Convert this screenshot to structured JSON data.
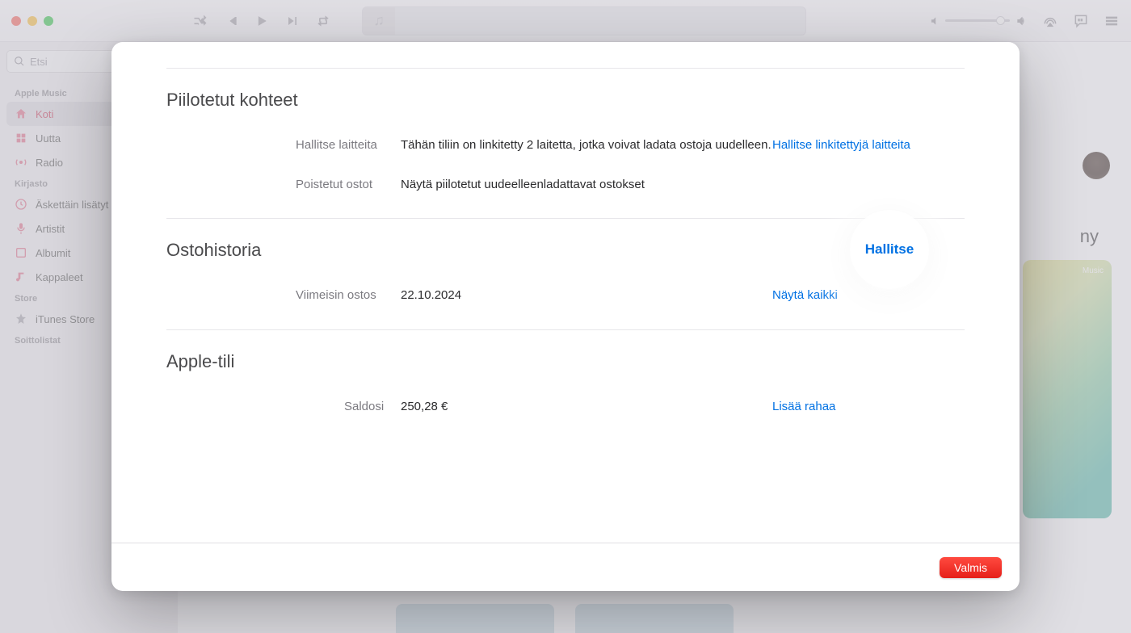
{
  "search_placeholder": "Etsi",
  "sidebar": {
    "section_music": "Apple Music",
    "home": "Koti",
    "new": "Uutta",
    "radio": "Radio",
    "section_library": "Kirjasto",
    "recent": "Äskettäin lisätyt",
    "artists": "Artistit",
    "albums": "Albumit",
    "songs": "Kappaleet",
    "section_store": "Store",
    "itunes": "iTunes Store",
    "section_playlists": "Soittolistat"
  },
  "bg": {
    "hero_word_partial": "ny",
    "hero_badge": "Music"
  },
  "modal": {
    "hidden": {
      "title": "Piilotetut kohteet",
      "devices_label": "Hallitse laitteita",
      "devices_text": "Tähän tiliin on linkitetty 2 laitetta, jotka voivat ladata ostoja uudelleen.",
      "devices_action": "Hallitse linkitettyjä laitteita",
      "removed_label": "Poistetut ostot",
      "removed_text": "Näytä piilotetut uudeelleenladattavat ostokset",
      "removed_action": "Hallitse"
    },
    "history": {
      "title": "Ostohistoria",
      "last_label": "Viimeisin ostos",
      "last_value": "22.10.2024",
      "action": "Näytä kaikki"
    },
    "account": {
      "title": "Apple-tili",
      "balance_label": "Saldosi",
      "balance_value": "250,28 €",
      "action": "Lisää rahaa"
    },
    "done": "Valmis"
  }
}
